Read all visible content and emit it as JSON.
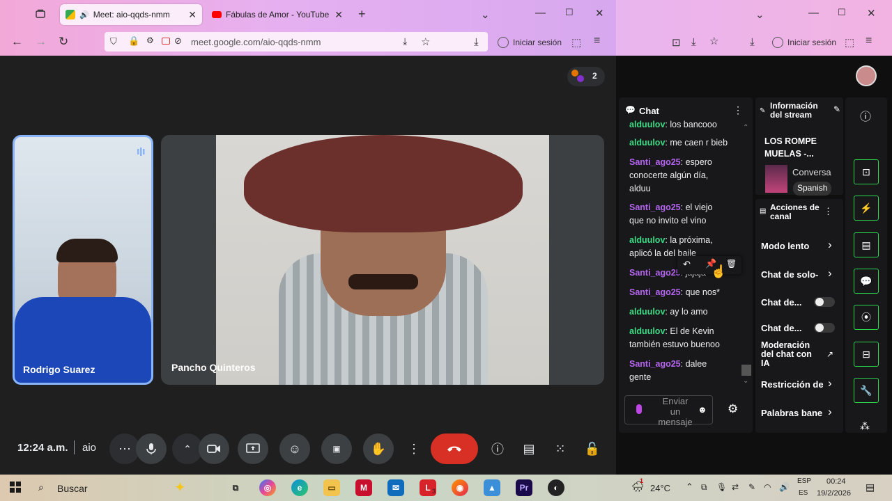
{
  "browser_left": {
    "tabs": [
      {
        "label": "Meet: aio-qqds-nmm",
        "active": true
      },
      {
        "label": "Fábulas de Amor - YouTube",
        "active": false
      }
    ],
    "new_tab": "+",
    "url": "meet.google.com/aio-qqds-nmm",
    "signin": "Iniciar sesión"
  },
  "browser_right": {
    "signin": "Iniciar sesión"
  },
  "meet": {
    "participant_count": "2",
    "participants": [
      {
        "name": "Rodrigo Suarez"
      },
      {
        "name": "Pancho Quinteros"
      }
    ],
    "time": "12:24 a.m.",
    "meeting_code": "aio",
    "accent_end_call": "#d93025",
    "active_tile_border": "#8ab4f8"
  },
  "chat": {
    "title": "Chat",
    "messages": [
      {
        "user": "alduulov",
        "text": "los bancooo",
        "color": "green"
      },
      {
        "user": "alduulov",
        "text": "me caen r bieb",
        "color": "green"
      },
      {
        "user": "Santi_ago25",
        "text": "espero conocerte algún día, alduu",
        "color": "purple"
      },
      {
        "user": "Santi_ago25",
        "text": "el viejo que no invito el vino",
        "color": "purple"
      },
      {
        "user": "alduulov",
        "text": "la próxima, aplicó la del baile",
        "color": "green"
      },
      {
        "user": "Santi_ago25",
        "text": "jajaja",
        "color": "purple"
      },
      {
        "user": "Santi_ago25",
        "text": "que nos*",
        "color": "purple"
      },
      {
        "user": "alduulov",
        "text": "ay lo amo",
        "color": "green"
      },
      {
        "user": "alduulov",
        "text": "El de Kevin también estuvo buenoo",
        "color": "green"
      },
      {
        "user": "Santi_ago25",
        "text": "dalee gente",
        "color": "purple"
      }
    ],
    "input_placeholder": "Enviar un mensaje"
  },
  "stream_info": {
    "title": "Información del stream",
    "stream_title": "LOS ROMPE MUELAS -...",
    "category": "Conversa",
    "language": "Spanish"
  },
  "channel_actions": {
    "title": "Acciones de canal",
    "items": [
      {
        "label": "Modo lento",
        "kind": "arrow"
      },
      {
        "label": "Chat de solo-",
        "kind": "arrow"
      },
      {
        "label": "Chat de...",
        "kind": "toggle"
      },
      {
        "label": "Chat de...",
        "kind": "toggle"
      },
      {
        "label": "Moderación del chat con IA",
        "kind": "external"
      },
      {
        "label": "Restricción de",
        "kind": "arrow"
      },
      {
        "label": "Palabras bane",
        "kind": "arrow"
      }
    ]
  },
  "taskbar": {
    "search_placeholder": "Buscar",
    "weather_alert": "1",
    "temperature": "24°C",
    "language_top": "ESP",
    "language_bottom": "ES",
    "clock_time": "00:24",
    "clock_date": "19/2/2026",
    "app_badge": "3",
    "app_letter": "L"
  }
}
